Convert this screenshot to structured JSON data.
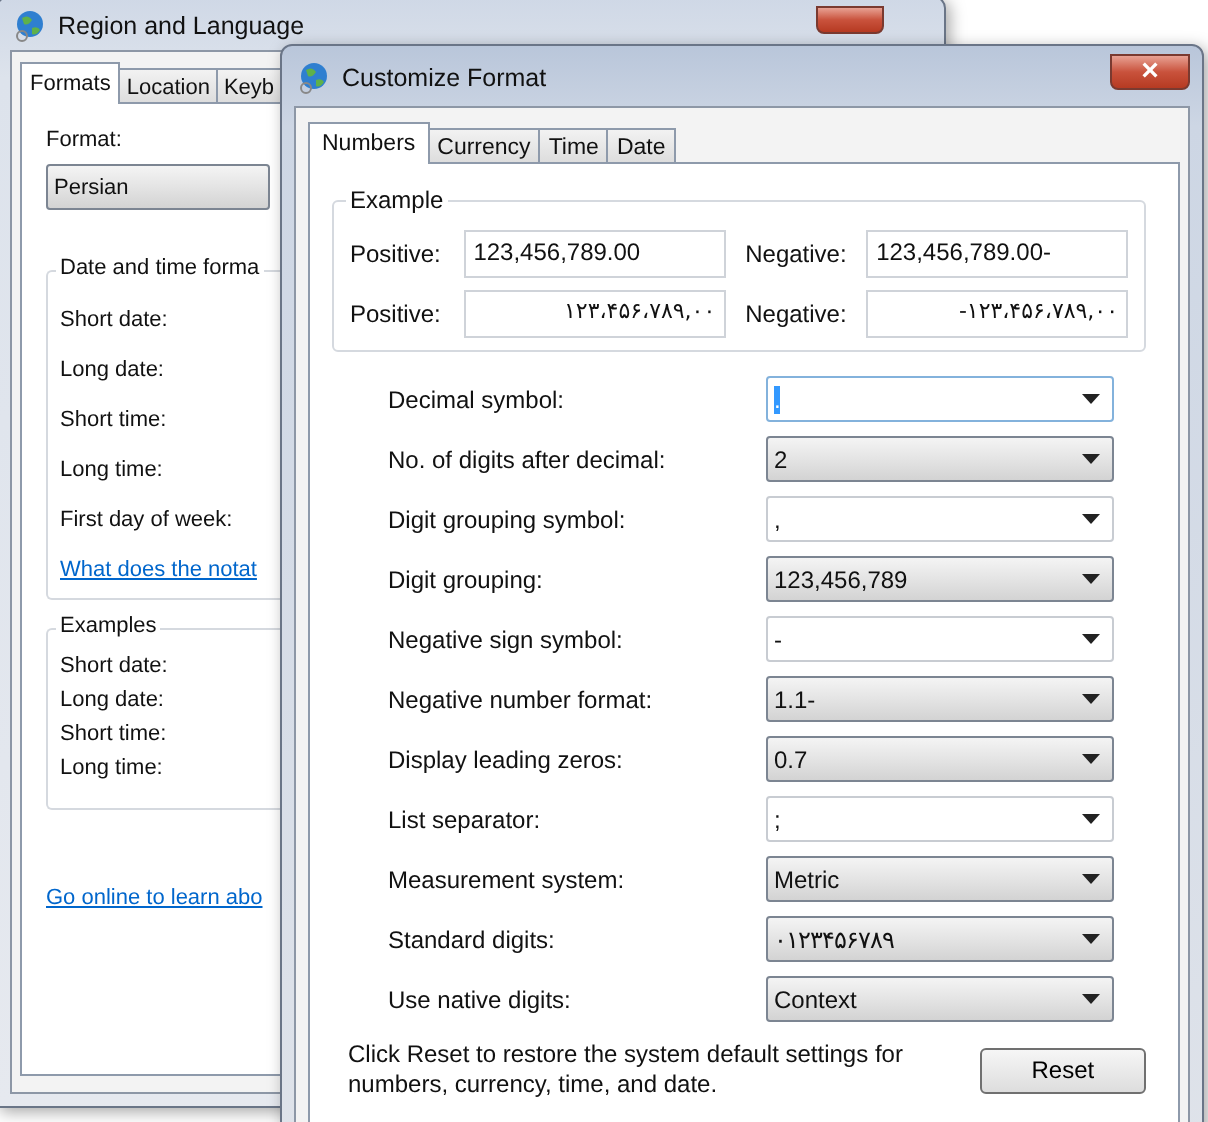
{
  "back_window": {
    "title": "Region and Language",
    "tabs": [
      {
        "label": "Formats",
        "selected": true
      },
      {
        "label": "Location",
        "selected": false
      },
      {
        "label": "Keyb",
        "selected": false
      }
    ],
    "format_label": "Format:",
    "format_value": "Persian",
    "date_time_group": {
      "title": "Date and time forma",
      "labels": [
        "Short date:",
        "Long date:",
        "Short time:",
        "Long time:",
        "First day of week:"
      ],
      "link": "What does the notat"
    },
    "examples_group": {
      "title": "Examples",
      "labels": [
        "Short date:",
        "Long date:",
        "Short time:",
        "Long time:"
      ]
    },
    "online_link": "Go online to learn abo"
  },
  "dialog": {
    "title": "Customize Format",
    "close": "×",
    "tabs": [
      {
        "label": "Numbers",
        "selected": true
      },
      {
        "label": "Currency",
        "selected": false
      },
      {
        "label": "Time",
        "selected": false
      },
      {
        "label": "Date",
        "selected": false
      }
    ],
    "example": {
      "title": "Example",
      "rows": [
        {
          "label": "Positive:",
          "value": "123,456,789.00",
          "neg_label": "Negative:",
          "neg_value": "123,456,789.00-",
          "kind": "latin"
        },
        {
          "label": "Positive:",
          "value": "۱۲۳،۴۵۶،۷۸۹,۰۰",
          "neg_label": "Negative:",
          "neg_value": "-۱۲۳،۴۵۶،۷۸۹,۰۰",
          "kind": "native"
        }
      ]
    },
    "settings": [
      {
        "label": "Decimal symbol:",
        "value": ".",
        "kind": "editable",
        "focused": true
      },
      {
        "label": "No. of digits after decimal:",
        "value": "2",
        "kind": "list",
        "focused": false
      },
      {
        "label": "Digit grouping symbol:",
        "value": ",",
        "kind": "editable",
        "focused": false
      },
      {
        "label": "Digit grouping:",
        "value": "123,456,789",
        "kind": "list",
        "focused": false
      },
      {
        "label": "Negative sign symbol:",
        "value": "-",
        "kind": "editable",
        "focused": false
      },
      {
        "label": "Negative number format:",
        "value": "1.1-",
        "kind": "list",
        "focused": false
      },
      {
        "label": "Display leading zeros:",
        "value": "0.7",
        "kind": "list",
        "focused": false
      },
      {
        "label": "List separator:",
        "value": ";",
        "kind": "editable",
        "focused": false
      },
      {
        "label": "Measurement system:",
        "value": "Metric",
        "kind": "list",
        "focused": false
      },
      {
        "label": "Standard digits:",
        "value": "۰۱۲۳۴۵۶۷۸۹",
        "kind": "list",
        "focused": false
      },
      {
        "label": "Use native digits:",
        "value": "Context",
        "kind": "list",
        "focused": false
      }
    ],
    "footer_text": "Click Reset to restore the system default settings for numbers, currency, time, and date.",
    "reset_button": "Reset"
  }
}
